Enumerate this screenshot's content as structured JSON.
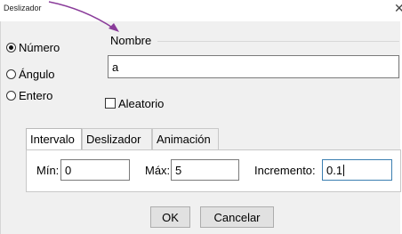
{
  "window": {
    "title": "Deslizador",
    "close_glyph": "✕"
  },
  "type_options": [
    {
      "label": "Número",
      "checked": true
    },
    {
      "label": "Ángulo",
      "checked": false
    },
    {
      "label": "Entero",
      "checked": false
    }
  ],
  "name_group": {
    "label": "Nombre",
    "value": "a"
  },
  "random_checkbox": {
    "label": "Aleatorio",
    "checked": false
  },
  "tabs": [
    {
      "label": "Intervalo",
      "active": true
    },
    {
      "label": "Deslizador",
      "active": false
    },
    {
      "label": "Animación",
      "active": false
    }
  ],
  "interval": {
    "min_label": "Mín:",
    "min_value": "0",
    "max_label": "Máx:",
    "max_value": "5",
    "increment_label": "Incremento:",
    "increment_value": "0.1"
  },
  "buttons": {
    "ok": "OK",
    "cancel": "Cancelar"
  },
  "annotation": {
    "arrow_color": "#8a3c9a",
    "icon": "arrow-pointer-icon"
  }
}
